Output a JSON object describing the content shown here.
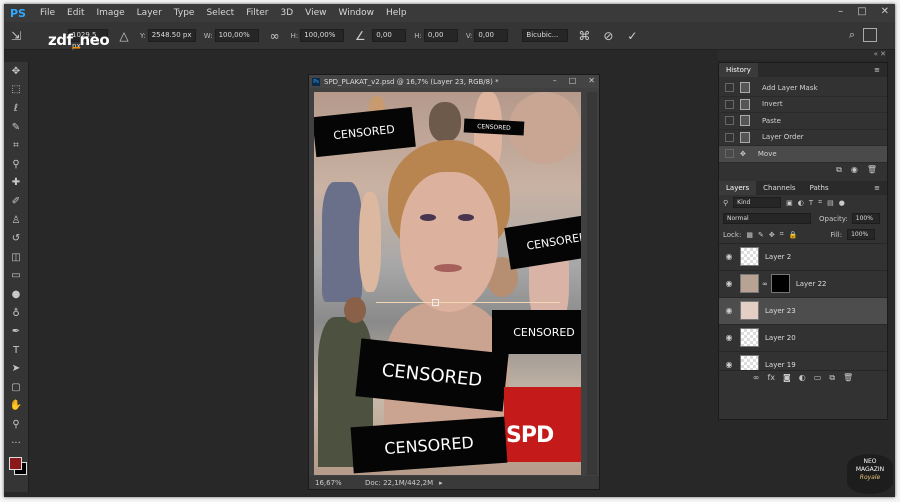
{
  "app": {
    "logo": "PS"
  },
  "menu": [
    "File",
    "Edit",
    "Image",
    "Layer",
    "Type",
    "Select",
    "Filter",
    "3D",
    "View",
    "Window",
    "Help"
  ],
  "window_controls": [
    "–",
    "□",
    "✕"
  ],
  "channel_logo": {
    "zdf": "zdf",
    "underscore": "_",
    "neo": "neo"
  },
  "options": {
    "x_value": "1029.5 px",
    "y_label": "Y:",
    "y_value": "2548.50 px",
    "w_label": "W:",
    "w_value": "100,00%",
    "link_glyph": "∞",
    "h_label": "H:",
    "h_value": "100,00%",
    "angle_glyph": "∠",
    "angle_value": "0,00",
    "hskew_label": "H:",
    "hskew_value": "0,00",
    "vskew_label": "V:",
    "vskew_value": "0,00",
    "interpolation": "Bicubic...",
    "search_glyph": "⌕"
  },
  "document": {
    "title": "SPD_PLAKAT_v2.psd @ 16,7% (Layer 23, RGB/8) *",
    "close_glyph": "✕",
    "zoom": "16,67%",
    "doc_size": "Doc: 22,1M/442,2M",
    "ps_badge": "Ps"
  },
  "canvas": {
    "censors": [
      "CENSORED",
      "CENSORED",
      "CENSORED",
      "CENSORED",
      "CENSORED",
      "CENSORED"
    ],
    "spd_logo": "SPD"
  },
  "history": {
    "tab_label": "History",
    "items": [
      {
        "label": "Add Layer Mask"
      },
      {
        "label": "Invert"
      },
      {
        "label": "Paste"
      },
      {
        "label": "Layer Order"
      },
      {
        "label": "Move"
      }
    ]
  },
  "layers_panel": {
    "tabs": [
      "Layers",
      "Channels",
      "Paths"
    ],
    "filter_kind": "Kind",
    "blend_mode": "Normal",
    "opacity_label": "Opacity:",
    "opacity": "100%",
    "lock_label": "Lock:",
    "fill_label": "Fill:",
    "fill": "100%",
    "layers": [
      {
        "name": "Layer 2",
        "selected": false
      },
      {
        "name": "Layer 22",
        "selected": false
      },
      {
        "name": "Layer 23",
        "selected": true
      },
      {
        "name": "Layer 20",
        "selected": false
      },
      {
        "name": "Layer 19",
        "selected": false
      }
    ]
  },
  "watermark": {
    "line1": "NEO",
    "line2": "MAGAZIN",
    "line3": "Royale"
  },
  "colors": {
    "foreground": "#8a1a1a",
    "background": "#000000",
    "spd_red": "#c41a1a",
    "ps_blue": "#31a8ff"
  }
}
